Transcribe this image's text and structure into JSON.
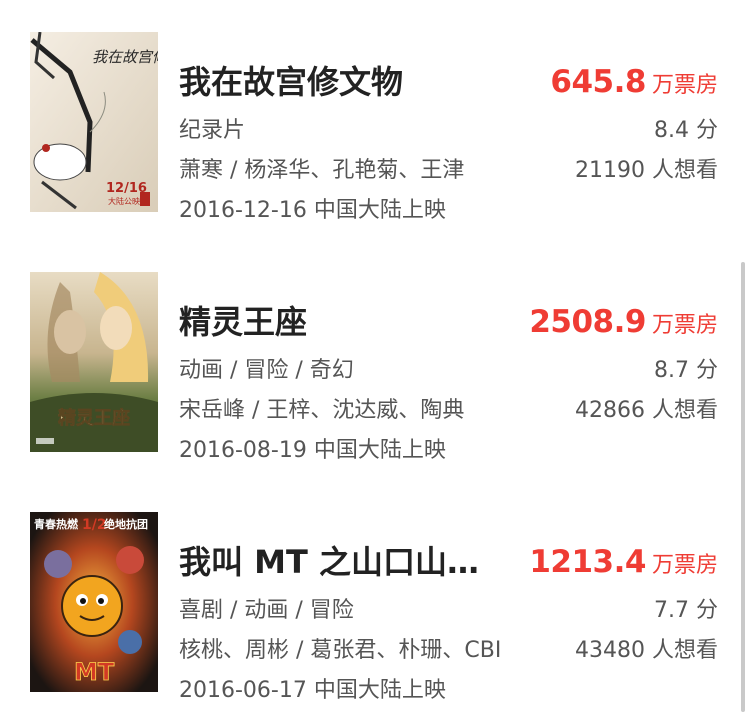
{
  "movies": [
    {
      "title": "我在故宫修文物",
      "box_office": "645.8",
      "box_unit": "万票房",
      "genre": "纪录片",
      "rating": "8.4 分",
      "people": "萧寒 / 杨泽华、孔艳菊、王津",
      "want": "21190 人想看",
      "release": "2016-12-16 中国大陆上映",
      "poster": {
        "icon": "crane-poster-icon",
        "text_vertical": "我在故宫修文物",
        "date": "12/16",
        "date_sub": "大陆公映",
        "colors": {
          "bg": "#efe7da",
          "accent": "#b1271f",
          "ink": "#2a2a2a"
        }
      }
    },
    {
      "title": "精灵王座",
      "box_office": "2508.9",
      "box_unit": "万票房",
      "genre": "动画 / 冒险 / 奇幻",
      "rating": "8.7 分",
      "people": "宋岳峰 / 王梓、沈达威、陶典",
      "want": "42866 人想看",
      "release": "2016-08-19 中国大陆上映",
      "poster": {
        "icon": "elf-poster-icon",
        "logo_text": "精灵王座",
        "colors": {
          "bg": "#5a6f3b",
          "accent": "#e9c36d",
          "ink": "#2b3a1f"
        }
      }
    },
    {
      "title": "我叫 MT 之山口山…",
      "box_office": "1213.4",
      "box_unit": "万票房",
      "genre": "喜剧 / 动画 / 冒险",
      "rating": "7.7 分",
      "people": "核桃、周彬 / 葛张君、朴珊、CBI",
      "want": "43480 人想看",
      "release": "2016-06-17 中国大陆上映",
      "poster": {
        "icon": "mt-cartoon-poster-icon",
        "top_text": "青春热燃",
        "top_red": "1/2",
        "top_text2": "绝地抗团",
        "logo_text": "MT",
        "colors": {
          "bg": "#221a16",
          "accent": "#f2a51f",
          "red": "#d23a24"
        }
      }
    }
  ],
  "accent_color": "#ef3c34"
}
